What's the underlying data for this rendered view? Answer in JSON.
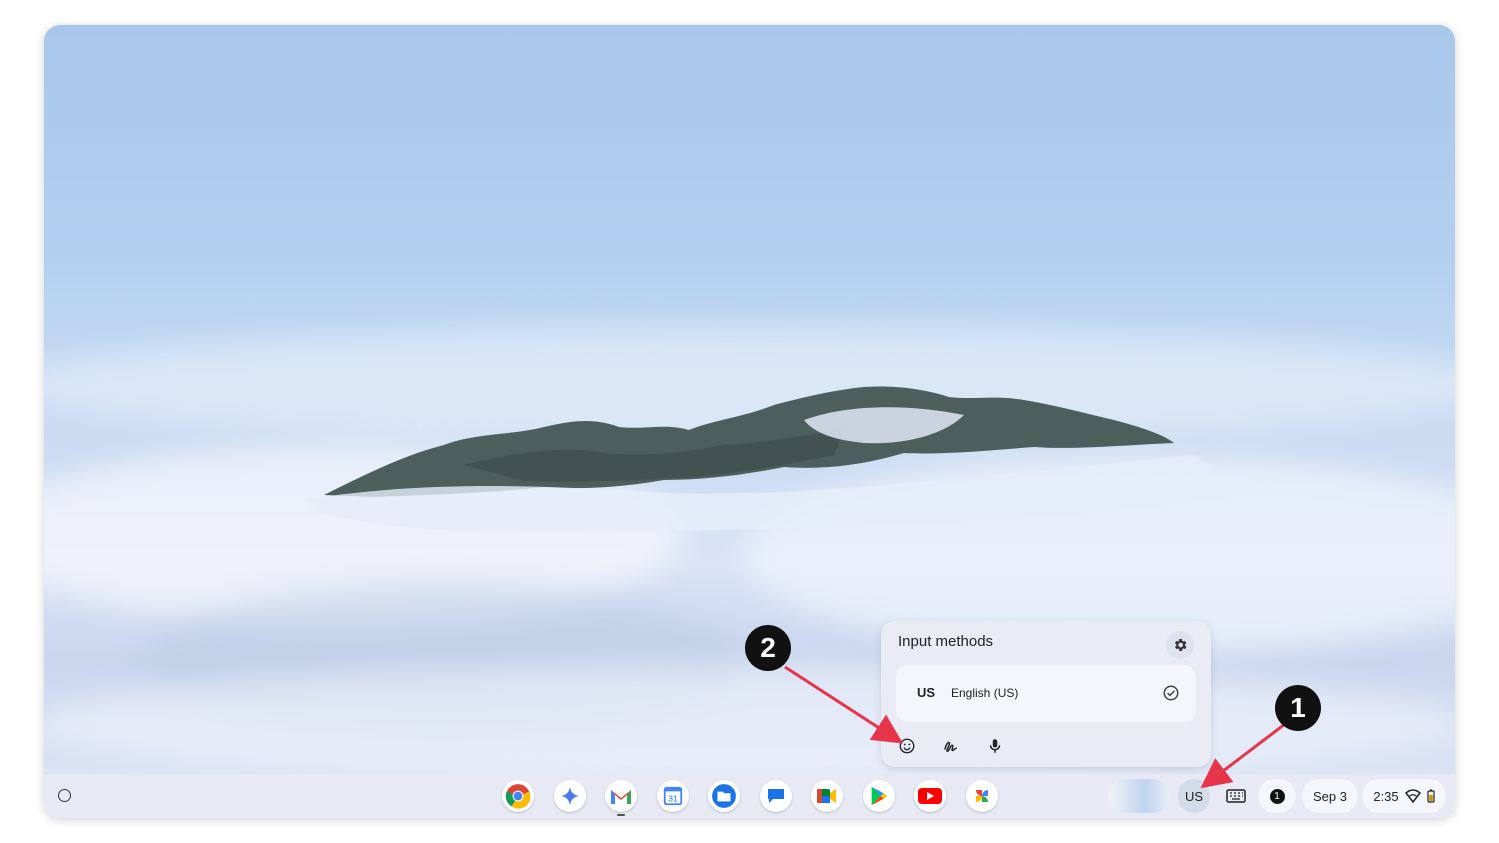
{
  "popup": {
    "title": "Input methods",
    "language": {
      "code": "US",
      "name": "English (US)",
      "selected": true
    },
    "tools": [
      "emoji-icon",
      "handwriting-icon",
      "microphone-icon"
    ]
  },
  "shelf": {
    "apps": [
      {
        "name": "chrome"
      },
      {
        "name": "gemini"
      },
      {
        "name": "gmail"
      },
      {
        "name": "calendar",
        "label": "31"
      },
      {
        "name": "files"
      },
      {
        "name": "messages"
      },
      {
        "name": "meet"
      },
      {
        "name": "play-store"
      },
      {
        "name": "youtube"
      },
      {
        "name": "photos"
      }
    ],
    "ime_label": "US",
    "notification_count": "1",
    "date": "Sep 3",
    "time": "2:35"
  },
  "annotations": {
    "marker_1": "1",
    "marker_2": "2"
  }
}
